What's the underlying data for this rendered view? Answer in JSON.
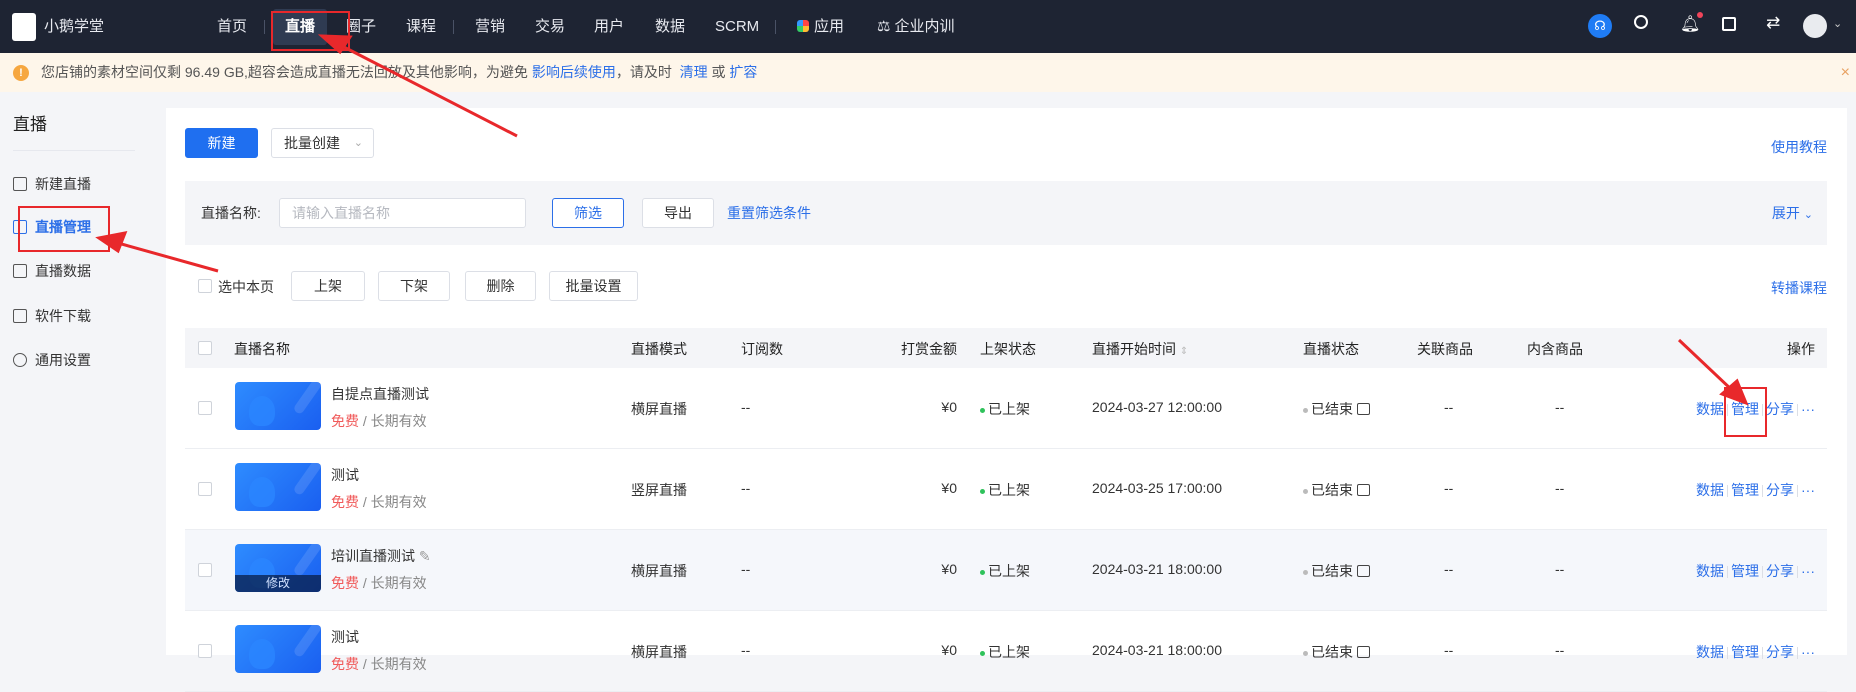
{
  "nav": {
    "brand": "小鹅学堂",
    "items": [
      "首页",
      "直播",
      "圈子",
      "课程",
      "营销",
      "交易",
      "用户",
      "数据",
      "SCRM",
      "应用",
      "企业内训"
    ],
    "active": "直播"
  },
  "banner": {
    "text": "您店铺的素材空间仅剩 96.49 GB,超容会造成直播无法回放及其他影响，为避免",
    "link1": "影响后续使用",
    "text2": "，请及时",
    "link2": "清理",
    "text3": "或",
    "link3": "扩容",
    "close": "×"
  },
  "sidebar": {
    "title": "直播",
    "items": [
      {
        "label": "新建直播",
        "icon": "video-icon"
      },
      {
        "label": "直播管理",
        "icon": "list-icon"
      },
      {
        "label": "直播数据",
        "icon": "chart-icon"
      },
      {
        "label": "软件下载",
        "icon": "download-icon"
      },
      {
        "label": "通用设置",
        "icon": "gear-icon"
      }
    ],
    "active": "直播管理"
  },
  "toolbar": {
    "new": "新建",
    "batch_create": "批量创建",
    "tutorial": "使用教程"
  },
  "filter": {
    "label": "直播名称:",
    "placeholder": "请输入直播名称",
    "filter": "筛选",
    "export": "导出",
    "reset": "重置筛选条件",
    "expand": "展开"
  },
  "batch": {
    "select_page": "选中本页",
    "on_shelf": "上架",
    "off_shelf": "下架",
    "delete": "删除",
    "settings": "批量设置",
    "relay": "转播课程"
  },
  "table": {
    "headers": {
      "name": "直播名称",
      "mode": "直播模式",
      "subs": "订阅数",
      "tips": "打赏金额",
      "shelf": "上架状态",
      "start": "直播开始时间",
      "status": "直播状态",
      "related": "关联商品",
      "contains": "内含商品",
      "ops": "操作"
    },
    "rows": [
      {
        "title": "自提点直播测试",
        "price": "免费",
        "validity": "/ 长期有效",
        "mode": "横屏直播",
        "subs": "--",
        "tips": "¥0",
        "shelf": "已上架",
        "start": "2024-03-27 12:00:00",
        "status": "已结束",
        "related": "--",
        "contains": "--"
      },
      {
        "title": "测试",
        "price": "免费",
        "validity": "/ 长期有效",
        "mode": "竖屏直播",
        "subs": "--",
        "tips": "¥0",
        "shelf": "已上架",
        "start": "2024-03-25 17:00:00",
        "status": "已结束",
        "related": "--",
        "contains": "--"
      },
      {
        "title": "培训直播测试",
        "price": "免费",
        "validity": "/ 长期有效",
        "mode": "横屏直播",
        "subs": "--",
        "tips": "¥0",
        "shelf": "已上架",
        "start": "2024-03-21 18:00:00",
        "status": "已结束",
        "related": "--",
        "contains": "--",
        "edit": "修改",
        "hover": true
      },
      {
        "title": "测试",
        "price": "免费",
        "validity": "/ 长期有效",
        "mode": "横屏直播",
        "subs": "--",
        "tips": "¥0",
        "shelf": "已上架",
        "start": "2024-03-21 18:00:00",
        "status": "已结束",
        "related": "--",
        "contains": "--"
      }
    ],
    "actions": {
      "data": "数据",
      "manage": "管理",
      "share": "分享",
      "more": "···"
    }
  },
  "colors": {
    "accent": "#1f6ff0",
    "nav_bg": "#1e2433",
    "annotation": "#e8282b",
    "free": "#f05a5a",
    "on_shelf": "#2fc25b"
  }
}
